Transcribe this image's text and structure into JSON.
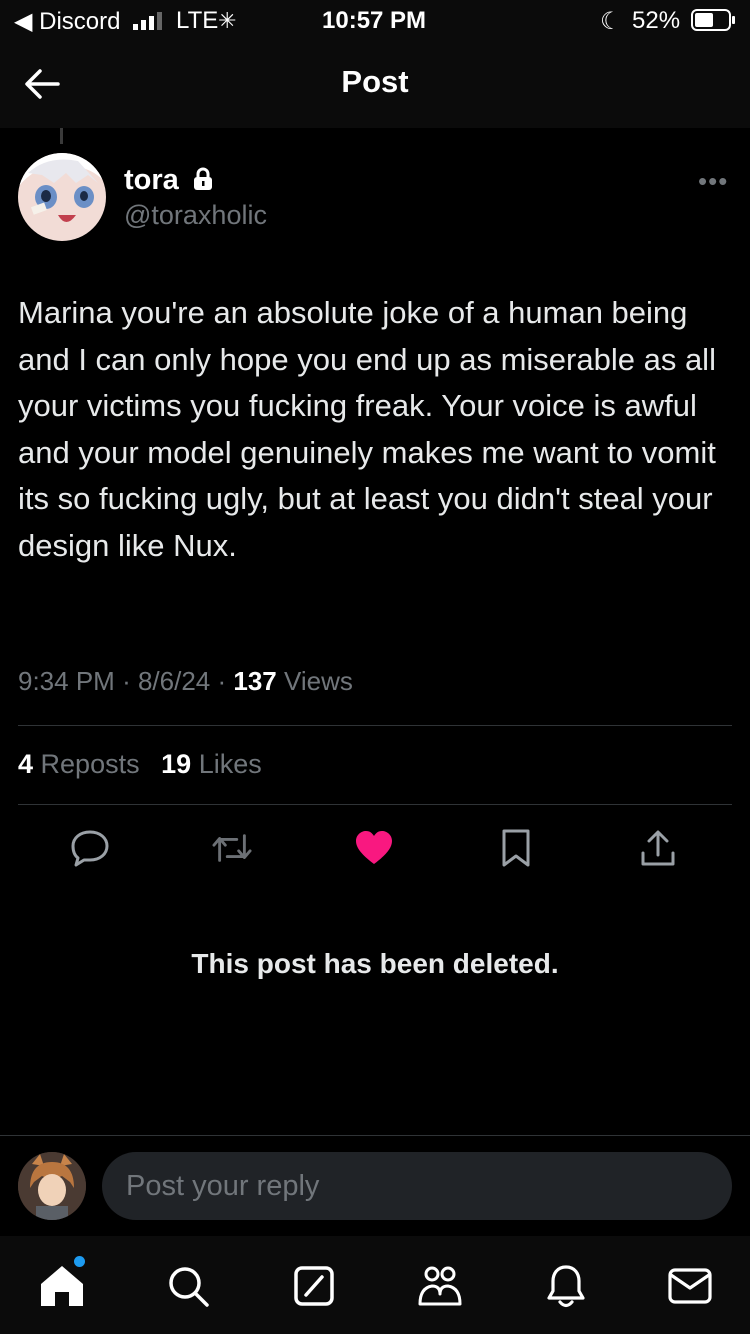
{
  "status_bar": {
    "back_app": "◀ Discord",
    "carrier": "LTE",
    "time": "10:57 PM",
    "battery": "52%"
  },
  "header": {
    "title": "Post"
  },
  "post": {
    "display_name": "tora",
    "handle": "@toraxholic",
    "text": "Marina you're an absolute joke of a human being and I can only hope you end up as miserable as all your victims you fucking freak. Your voice is awful and your model genuinely makes me want to vomit its so fucking ugly, but at least you didn't steal your design like Nux.",
    "time": "9:34 PM",
    "date": "8/6/24",
    "views_count": "137",
    "views_label": "Views",
    "reposts_count": "4",
    "reposts_label": "Reposts",
    "likes_count": "19",
    "likes_label": "Likes"
  },
  "deleted_notice": "This post has been deleted.",
  "reply": {
    "placeholder": "Post your reply"
  },
  "colors": {
    "like": "#f91880",
    "accent": "#1d9bf0",
    "muted": "#71767b",
    "background": "#000000"
  },
  "icons": {
    "header": [
      "back-arrow-icon",
      "more-icon",
      "lock-icon"
    ],
    "actions": [
      "reply-icon",
      "repost-icon",
      "like-icon",
      "bookmark-icon",
      "share-icon"
    ],
    "tabs": [
      "home-icon",
      "search-icon",
      "grok-icon",
      "communities-icon",
      "notifications-icon",
      "messages-icon"
    ]
  }
}
